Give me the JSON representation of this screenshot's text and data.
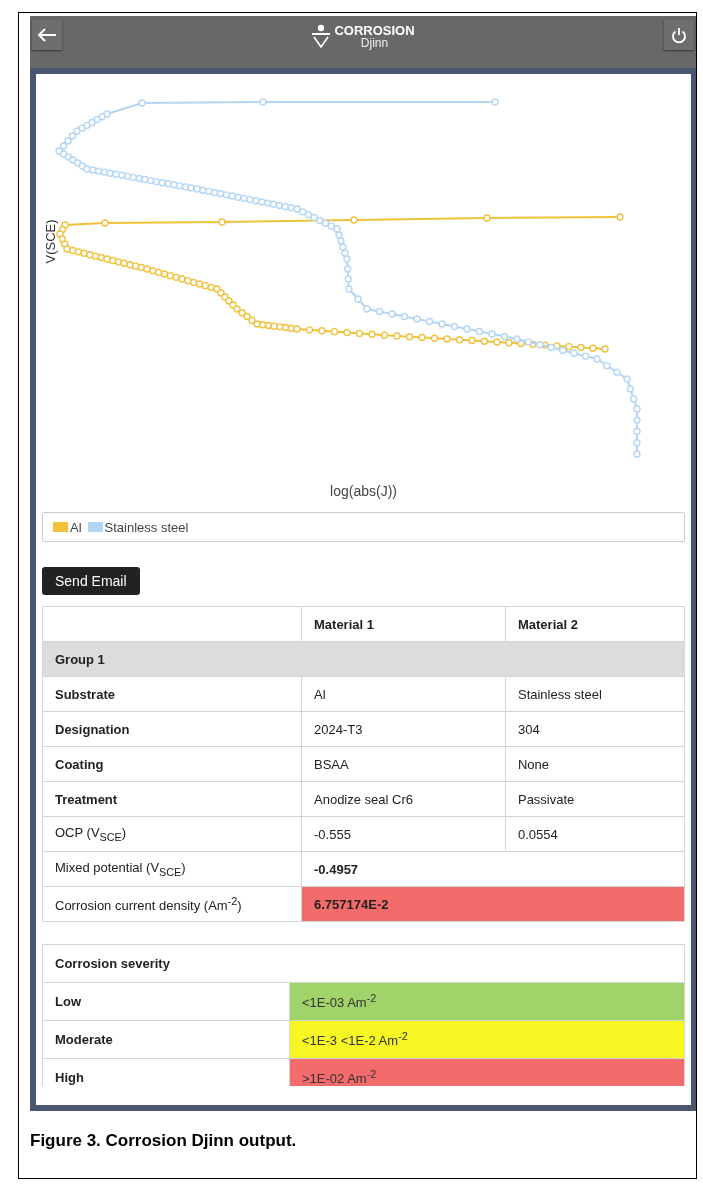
{
  "header": {
    "logo_title": "CORROSION",
    "logo_subtitle": "Djinn"
  },
  "chart": {
    "ylabel": "V(SCE)",
    "xlabel": "log(abs(J))"
  },
  "legend": [
    {
      "label": "Al",
      "color": "#f0c23c"
    },
    {
      "label": "Stainless steel",
      "color": "#b3d6f5"
    }
  ],
  "send_button": "Send Email",
  "table": {
    "columns": [
      "Material 1",
      "Material 2"
    ],
    "rows": [
      {
        "kind": "group",
        "label": "Group 1"
      },
      {
        "kind": "property",
        "label": "Substrate",
        "values": [
          "Al",
          "Stainless steel"
        ]
      },
      {
        "kind": "property",
        "label": "Designation",
        "values": [
          "2024-T3",
          "304"
        ]
      },
      {
        "kind": "property",
        "label": "Coating",
        "values": [
          "BSAA",
          "None"
        ]
      },
      {
        "kind": "property",
        "label": "Treatment",
        "values": [
          "Anodize seal Cr6",
          "Passivate"
        ]
      },
      {
        "kind": "result",
        "label": "OCP (V$_{SCE}$)",
        "values": [
          "-0.555",
          "0.0554"
        ]
      },
      {
        "kind": "combined",
        "label": "Mixed potential (V$_{SCE}$)",
        "value": "-0.4957"
      },
      {
        "kind": "combined",
        "label": "Corrosion current density (Am$^{-2}$)",
        "value": "6.757174E-2",
        "color": "#f46b6b"
      }
    ]
  },
  "severity": {
    "title": "Corrosion severity",
    "levels": [
      {
        "label": "Low",
        "range": "<1E-03 Am$^{-2}$",
        "color": "#a0d36a"
      },
      {
        "label": "Moderate",
        "range": "<1E-3 <1E-2 Am$^{-2}$",
        "color": "#f7f723"
      },
      {
        "label": "High",
        "range": ">1E-02 Am$^{-2}$",
        "color": "#f46b6b"
      }
    ]
  },
  "caption": "Figure 3.  Corrosion Djinn output."
}
